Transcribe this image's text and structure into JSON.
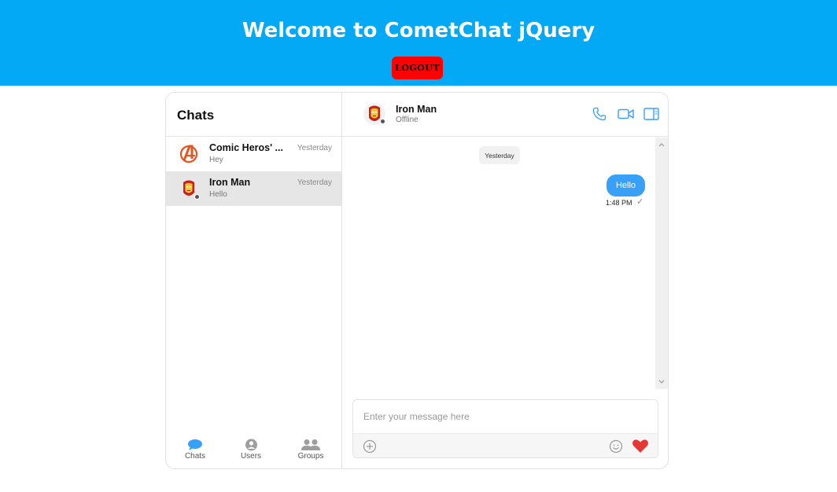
{
  "header": {
    "title": "Welcome to CometChat jQuery",
    "logout_label": "LOGOUT"
  },
  "colors": {
    "header_bg": "#03a9f4",
    "logout_bg": "#ff0000",
    "accent": "#39a0f8",
    "active_row": "#e6e6e6",
    "heart": "#e53935"
  },
  "sidebar": {
    "title": "Chats",
    "conversations": [
      {
        "name": "Comic Heros' ...",
        "preview": "Hey",
        "time": "Yesterday",
        "avatar": "avengers-logo-icon",
        "active": false
      },
      {
        "name": "Iron Man",
        "preview": "Hello",
        "time": "Yesterday",
        "avatar": "iron-man-avatar-icon",
        "active": true
      }
    ],
    "nav": [
      {
        "label": "Chats",
        "icon": "chat-bubble-icon",
        "active": true
      },
      {
        "label": "Users",
        "icon": "user-icon",
        "active": false
      },
      {
        "label": "Groups",
        "icon": "group-icon",
        "active": false
      }
    ]
  },
  "chat": {
    "name": "Iron Man",
    "status": "Offline",
    "date_separator": "Yesterday",
    "messages": [
      {
        "text": "Hello",
        "time": "1:48 PM",
        "receipt": "✓",
        "outgoing": true
      }
    ],
    "composer_placeholder": "Enter your message here"
  }
}
